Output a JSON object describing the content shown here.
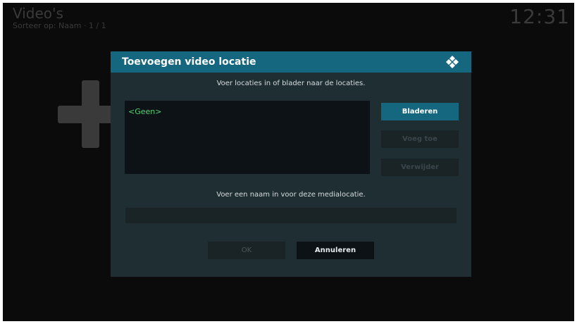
{
  "app": {
    "title": "Video's",
    "sort_info": "Sorteer op: Naam  ·  1 / 1",
    "time": "12:31"
  },
  "dialog": {
    "title": "Toevoegen video locatie",
    "paths_hint": "Voer locaties in of blader naar de locaties.",
    "paths": [
      "<Geen>"
    ],
    "browse_label": "Bladeren",
    "add_label": "Voeg toe",
    "remove_label": "Verwijder",
    "name_hint": "Voer een naam in voor deze medialocatie.",
    "name_value": "",
    "ok_label": "OK",
    "cancel_label": "Annuleren"
  },
  "icons": {
    "add_source": "plus-icon",
    "logo": "kodi-logo-icon"
  },
  "colors": {
    "accent": "#15677f",
    "path_text": "#55d174"
  }
}
